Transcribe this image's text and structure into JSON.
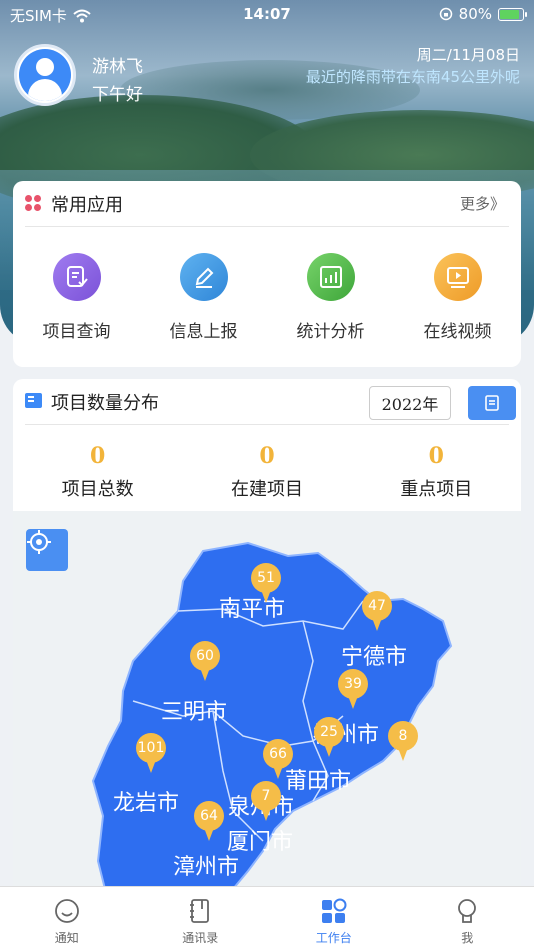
{
  "status_bar": {
    "carrier": "无SIM卡",
    "time": "14:07",
    "battery": "80%",
    "battery_level": 0.8
  },
  "header": {
    "username": "游林飞",
    "greeting": "下午好",
    "date": "周二/11月08日",
    "weather": "最近的降雨带在东南45公里外呢"
  },
  "common_apps": {
    "title": "常用应用",
    "more": "更多》",
    "items": [
      {
        "label": "项目查询",
        "icon": "search-doc-icon",
        "color": "#8a63e0"
      },
      {
        "label": "信息上报",
        "icon": "pencil-icon",
        "color": "#3b8fe0"
      },
      {
        "label": "统计分析",
        "icon": "chart-icon",
        "color": "#4fb84b"
      },
      {
        "label": "在线视频",
        "icon": "video-icon",
        "color": "#f2a634"
      }
    ]
  },
  "projects": {
    "title": "项目数量分布",
    "year": "2022年",
    "stats": [
      {
        "value": "0",
        "label": "项目总数"
      },
      {
        "value": "0",
        "label": "在建项目"
      },
      {
        "value": "0",
        "label": "重点项目"
      }
    ]
  },
  "map": {
    "cities": [
      "南平市",
      "宁德市",
      "三明市",
      "福州市",
      "莆田市",
      "龙岩市",
      "泉州市",
      "厦门市",
      "漳州市"
    ],
    "pins": [
      "51",
      "47",
      "60",
      "39",
      "25",
      "8",
      "101",
      "66",
      "7",
      "64"
    ]
  },
  "tabs": [
    {
      "label": "通知",
      "icon": "smile-face-icon"
    },
    {
      "label": "通讯录",
      "icon": "contacts-book-icon"
    },
    {
      "label": "工作台",
      "icon": "workbench-grid-icon",
      "active": true
    },
    {
      "label": "我",
      "icon": "person-icon"
    }
  ]
}
